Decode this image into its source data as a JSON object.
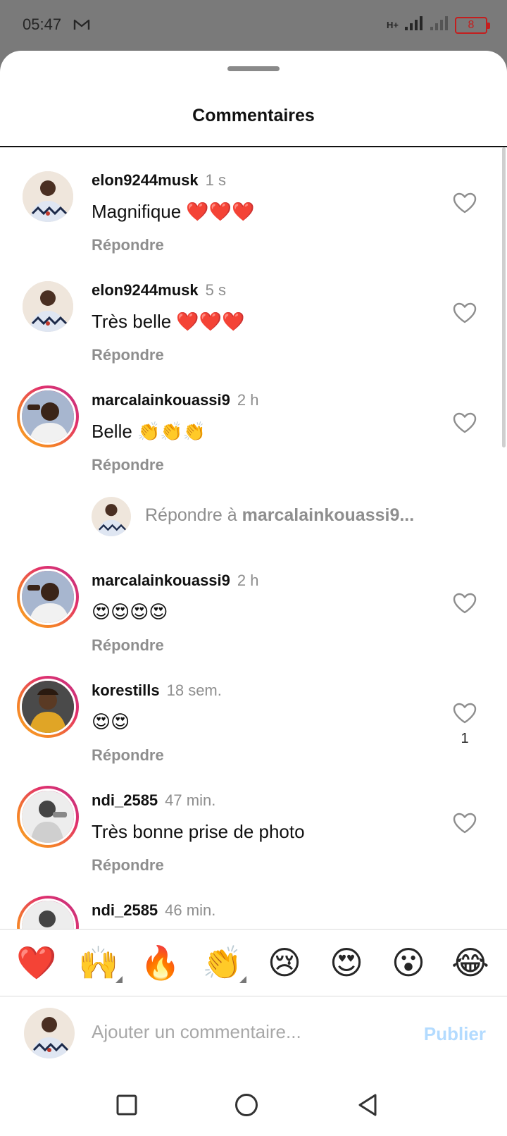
{
  "status_bar": {
    "time": "05:47",
    "battery": "8",
    "network": "H+"
  },
  "sheet": {
    "title": "Commentaires"
  },
  "reply_label": "Répondre",
  "comments": [
    {
      "user": "elon9244musk",
      "time": "1 s",
      "text": "Magnifique ❤️❤️❤️",
      "likes": ""
    },
    {
      "user": "elon9244musk",
      "time": "5 s",
      "text": "Très belle ❤️❤️❤️",
      "likes": ""
    },
    {
      "user": "marcalainkouassi9",
      "time": "2 h",
      "text": "Belle 👏👏👏",
      "likes": ""
    },
    {
      "user": "marcalainkouassi9",
      "time": "2 h",
      "text": "😍😍😍😍",
      "likes": ""
    },
    {
      "user": "korestills",
      "time": "18 sem.",
      "text": "😍😍",
      "likes": "1"
    },
    {
      "user": "ndi_2585",
      "time": "47 min.",
      "text": "Très bonne prise de photo",
      "likes": ""
    },
    {
      "user": "ndi_2585",
      "time": "46 min.",
      "text": "",
      "likes": ""
    }
  ],
  "reply_prompt": {
    "prefix": "Répondre à ",
    "user": "marcalainkouassi9..."
  },
  "emoji_bar": [
    "❤️",
    "🙌",
    "🔥",
    "👏",
    "😢",
    "😍",
    "😮",
    "😂"
  ],
  "composer": {
    "placeholder": "Ajouter un commentaire...",
    "publish_label": "Publier"
  },
  "colors": {
    "accent_disabled": "#b3dbff",
    "secondary_text": "#8e8e8e",
    "battery_low": "#c41e1e"
  }
}
